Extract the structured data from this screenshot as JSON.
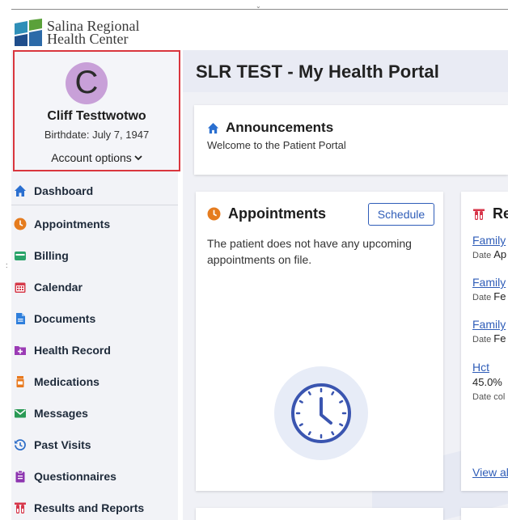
{
  "logo": {
    "line1": "Salina Regional",
    "line2": "Health Center"
  },
  "profile": {
    "initial": "C",
    "name": "Cliff Testtwotwo",
    "birthdate": "Birthdate: July 7, 1947",
    "account_options": "Account options",
    "chevron": "⌄"
  },
  "nav": {
    "items": [
      {
        "label": "Dashboard",
        "icon": "home-icon",
        "color": "#2a6fd0"
      },
      {
        "label": "Appointments",
        "icon": "clock-icon",
        "color": "#e57c1f"
      },
      {
        "label": "Billing",
        "icon": "wallet-icon",
        "color": "#2aa46a"
      },
      {
        "label": "Calendar",
        "icon": "calendar-icon",
        "color": "#d63a4a"
      },
      {
        "label": "Documents",
        "icon": "document-icon",
        "color": "#2f7fdc"
      },
      {
        "label": "Health Record",
        "icon": "medical-folder-icon",
        "color": "#9b3bb5"
      },
      {
        "label": "Medications",
        "icon": "pill-bottle-icon",
        "color": "#e8791e"
      },
      {
        "label": "Messages",
        "icon": "envelope-icon",
        "color": "#2a9a55"
      },
      {
        "label": "Past Visits",
        "icon": "history-icon",
        "color": "#2f6fc8"
      },
      {
        "label": "Questionnaires",
        "icon": "clipboard-icon",
        "color": "#8e35b0"
      },
      {
        "label": "Results and Reports",
        "icon": "test-tubes-icon",
        "color": "#d7364a"
      }
    ]
  },
  "header": {
    "title": "SLR TEST - My Health Portal"
  },
  "announcements": {
    "title": "Announcements",
    "message": "Welcome to the Patient Portal"
  },
  "appointments": {
    "title": "Appointments",
    "schedule_label": "Schedule",
    "empty_message": "The patient does not have any upcoming appointments on file."
  },
  "results": {
    "title": "Re",
    "items": [
      {
        "link": "Family",
        "date_label": "Date",
        "date_value": "Ap"
      },
      {
        "link": "Family",
        "date_label": "Date",
        "date_value": "Fe"
      },
      {
        "link": "Family",
        "date_label": "Date",
        "date_value": "Fe"
      }
    ],
    "hct": {
      "link": "Hct",
      "value": "45.0%",
      "note": "Date col"
    },
    "view_all": "View al"
  },
  "colors": {
    "accent": "#2f5db8",
    "highlight_border": "#d9363e",
    "avatar": "#c8a0d8",
    "header_bg": "#e9ebf4"
  }
}
